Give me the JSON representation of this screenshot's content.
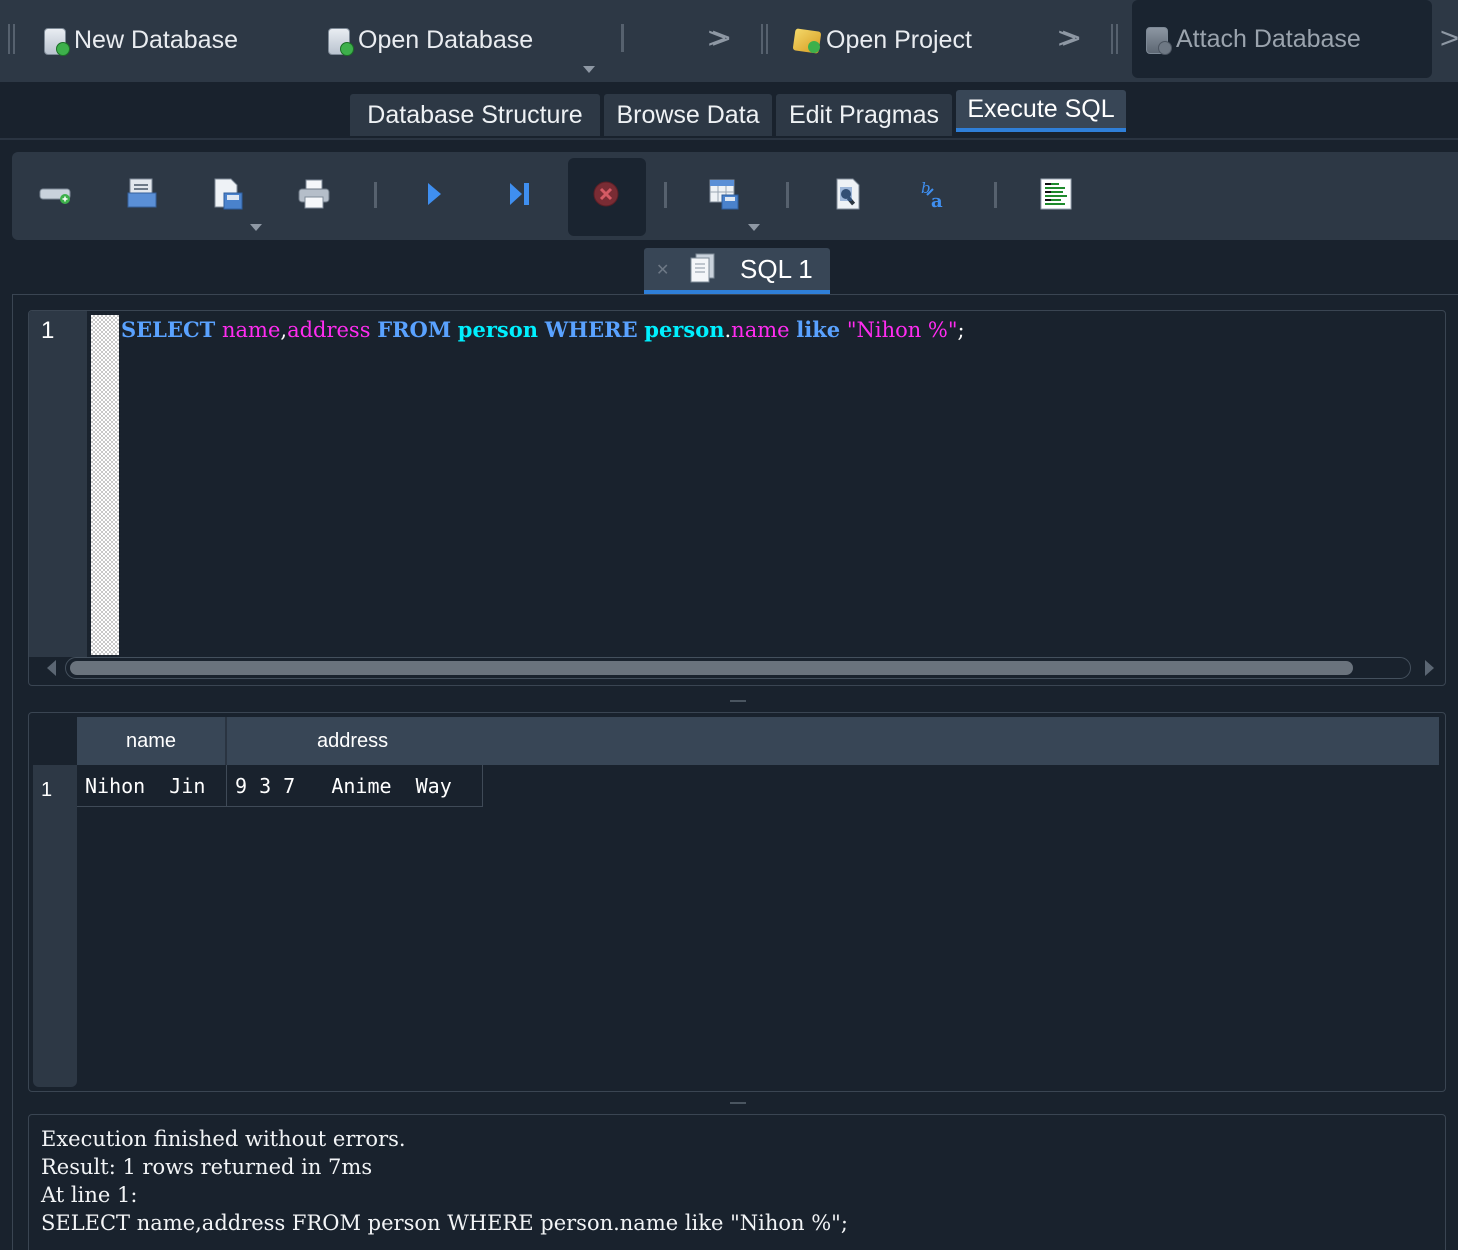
{
  "toolbar": {
    "new_database": "New Database",
    "open_database": "Open Database",
    "open_project": "Open Project",
    "attach_database": "Attach Database"
  },
  "main_tabs": [
    {
      "label": "Database Structure",
      "active": false
    },
    {
      "label": "Browse Data",
      "active": false
    },
    {
      "label": "Edit Pragmas",
      "active": false
    },
    {
      "label": "Execute SQL",
      "active": true
    }
  ],
  "sql_toolbar": {
    "icons": [
      "open-tab-icon",
      "open-sql-file-icon",
      "save-sql-file-icon",
      "print-icon",
      "execute-all-icon",
      "execute-current-line-icon",
      "stop-execution-icon",
      "save-results-icon",
      "find-icon",
      "find-replace-icon",
      "comment-icon"
    ]
  },
  "editor": {
    "tab_label": "SQL 1",
    "line_number": "1",
    "tokens": {
      "t0": "SELECT",
      "t1": " ",
      "t2": "name",
      "t3": ",",
      "t4": "address",
      "t5": " ",
      "t6": "FROM",
      "t7": " ",
      "t8": "person",
      "t9": " ",
      "t10": "WHERE",
      "t11": " ",
      "t12": "person",
      "t13": ".",
      "t14": "name",
      "t15": " ",
      "t16": "like",
      "t17": " ",
      "t18": "\"Nihon %\"",
      "t19": ";"
    },
    "scroll_position": 0.96
  },
  "results": {
    "columns": [
      "name",
      "address"
    ],
    "rows": [
      {
        "row_number": "1",
        "cells": [
          "Nihon  Jin",
          "9 3 7   Anime  Way"
        ]
      }
    ]
  },
  "messages": {
    "line1": "Execution finished without errors.",
    "line2": "Result: 1 rows returned in 7ms",
    "line3": "At line 1:",
    "line4": "SELECT name,address FROM person WHERE person.name like \"Nihon %\";"
  },
  "colors": {
    "background": "#19222d",
    "panel": "#2d3845",
    "accent": "#2f7fd8",
    "keyword": "#5aa2ff",
    "identifier": "#ff2cf0",
    "table_name": "#00f0ff"
  }
}
